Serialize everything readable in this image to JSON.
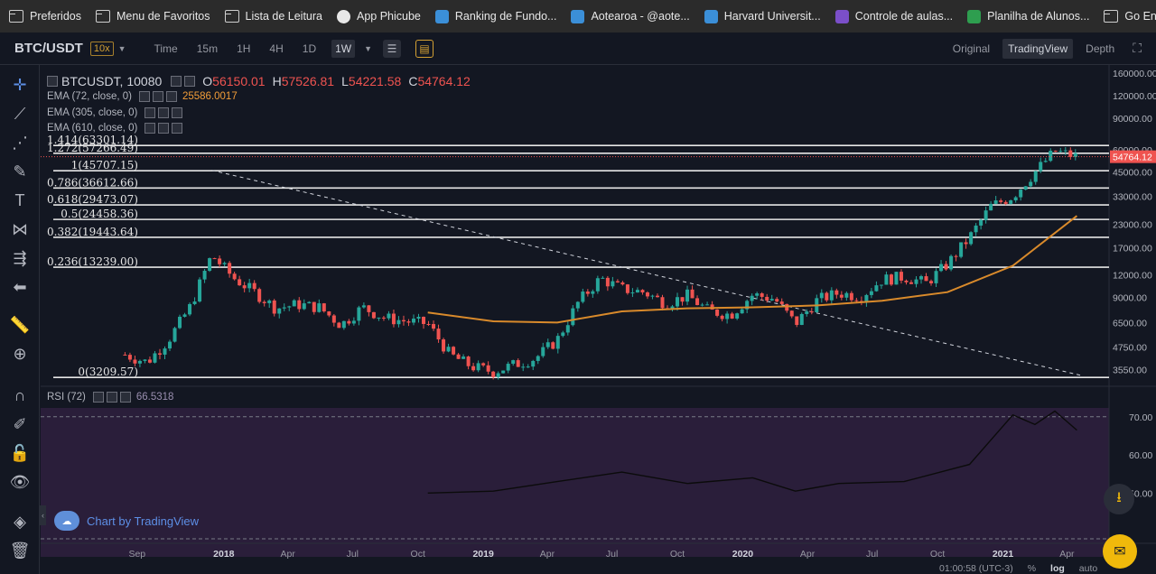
{
  "bookmarks": [
    {
      "label": "Preferidos",
      "icon": "folder-icon"
    },
    {
      "label": "Menu de Favoritos",
      "icon": "folder-icon"
    },
    {
      "label": "Lista de Leitura",
      "icon": "folder-icon"
    },
    {
      "label": "App Phicube",
      "icon": "globe-icon"
    },
    {
      "label": "Ranking de Fundo...",
      "icon": "site-icon"
    },
    {
      "label": "Aotearoa - @aote...",
      "icon": "site-icon"
    },
    {
      "label": "Harvard Universit...",
      "icon": "site-icon"
    },
    {
      "label": "Controle de aulas...",
      "icon": "form-icon"
    },
    {
      "label": "Planilha de Alunos...",
      "icon": "sheet-icon"
    },
    {
      "label": "Go English",
      "icon": "folder-icon"
    }
  ],
  "toolbar": {
    "pair": "BTC/USDT",
    "leverage": "10x",
    "timeframes": [
      "Time",
      "15m",
      "1H",
      "4H",
      "1D",
      "1W"
    ],
    "active_timeframe": "1W",
    "views": [
      "Original",
      "TradingView",
      "Depth"
    ],
    "active_view": "TradingView"
  },
  "legend": {
    "symbol": "BTCUSDT, 10080",
    "o_label": "O",
    "o": "56150.01",
    "h_label": "H",
    "h": "57526.81",
    "l_label": "L",
    "l": "54221.58",
    "c_label": "C",
    "c": "54764.12",
    "ema72": "EMA (72, close, 0)",
    "ema72_value": "25586.0017",
    "ema305": "EMA (305, close, 0)",
    "ema610": "EMA (610, close, 0)",
    "rsi": "RSI (72)",
    "rsi_value": "66.5318"
  },
  "price_axis": [
    "160000.00",
    "120000.00",
    "90000.00",
    "60000.00",
    "45000.00",
    "33000.00",
    "23000.00",
    "17000.00",
    "12000.00",
    "9000.00",
    "6500.00",
    "4750.00",
    "3550.00"
  ],
  "current_price": "54764.12",
  "rsi_axis": [
    "70.00",
    "60.00",
    "50.00"
  ],
  "time_axis": [
    "Sep",
    "2018",
    "Apr",
    "Jul",
    "Oct",
    "2019",
    "Apr",
    "Jul",
    "Oct",
    "2020",
    "Apr",
    "Jul",
    "Oct",
    "2021",
    "Apr"
  ],
  "fib_levels": [
    {
      "label": "1.414(63301.14)",
      "price": 63301.14
    },
    {
      "label": "1.272(57266.49)",
      "price": 57266.49
    },
    {
      "label": "1(45707.15)",
      "price": 45707.15
    },
    {
      "label": "0.786(36612.66)",
      "price": 36612.66
    },
    {
      "label": "0.618(29473.07)",
      "price": 29473.07
    },
    {
      "label": "0.5(24458.36)",
      "price": 24458.36
    },
    {
      "label": "0.382(19443.64)",
      "price": 19443.64
    },
    {
      "label": "0.236(13239.00)",
      "price": 13239.0
    },
    {
      "label": "0(3209.57)",
      "price": 3209.57
    }
  ],
  "colors": {
    "up": "#26a69a",
    "down": "#ef5350",
    "ema": "#d98a2b",
    "rsi_band": "#2a1e3a",
    "background": "#131722",
    "accent": "#f0b90b"
  },
  "watermark": "Chart by TradingView",
  "status": {
    "time": "01:00:58 (UTC-3)",
    "percent": "%",
    "log": "log",
    "auto": "auto"
  },
  "chart_data": {
    "type": "candlestick",
    "scale": "log",
    "ylim": [
      3000,
      170000
    ],
    "x_ticks": [
      "Sep",
      "2018",
      "Apr",
      "Jul",
      "Oct",
      "2019",
      "Apr",
      "Jul",
      "Oct",
      "2020",
      "Apr",
      "Jul",
      "Oct",
      "2021",
      "Apr"
    ],
    "close_path": [
      [
        "2017-08",
        4300
      ],
      [
        "2017-09",
        3900
      ],
      [
        "2017-10",
        5200
      ],
      [
        "2017-11",
        8000
      ],
      [
        "2017-12",
        15500
      ],
      [
        "2018-01",
        11500
      ],
      [
        "2018-02",
        9500
      ],
      [
        "2018-03",
        7800
      ],
      [
        "2018-04",
        8200
      ],
      [
        "2018-05",
        7900
      ],
      [
        "2018-06",
        6300
      ],
      [
        "2018-07",
        7900
      ],
      [
        "2018-08",
        6900
      ],
      [
        "2018-09",
        6600
      ],
      [
        "2018-10",
        6400
      ],
      [
        "2018-11",
        4300
      ],
      [
        "2018-12",
        3700
      ],
      [
        "2019-01",
        3450
      ],
      [
        "2019-02",
        3800
      ],
      [
        "2019-03",
        4100
      ],
      [
        "2019-04",
        5200
      ],
      [
        "2019-05",
        8500
      ],
      [
        "2019-06",
        11500
      ],
      [
        "2019-07",
        10000
      ],
      [
        "2019-08",
        9600
      ],
      [
        "2019-09",
        8300
      ],
      [
        "2019-10",
        9200
      ],
      [
        "2019-11",
        7500
      ],
      [
        "2019-12",
        7200
      ],
      [
        "2020-01",
        9300
      ],
      [
        "2020-02",
        8800
      ],
      [
        "2020-03",
        6400
      ],
      [
        "2020-04",
        8700
      ],
      [
        "2020-05",
        9500
      ],
      [
        "2020-06",
        9100
      ],
      [
        "2020-07",
        11300
      ],
      [
        "2020-08",
        11700
      ],
      [
        "2020-09",
        10800
      ],
      [
        "2020-10",
        13800
      ],
      [
        "2020-11",
        19400
      ],
      [
        "2020-12",
        29000
      ],
      [
        "2021-01",
        33000
      ],
      [
        "2021-02",
        45000
      ],
      [
        "2021-03",
        58800
      ],
      [
        "2021-04",
        54764
      ]
    ],
    "ema72_path": [
      [
        "2018-10",
        7400
      ],
      [
        "2019-01",
        6600
      ],
      [
        "2019-04",
        6500
      ],
      [
        "2019-07",
        7500
      ],
      [
        "2019-10",
        7800
      ],
      [
        "2020-01",
        7900
      ],
      [
        "2020-04",
        8100
      ],
      [
        "2020-07",
        8600
      ],
      [
        "2020-10",
        9600
      ],
      [
        "2021-01",
        13500
      ],
      [
        "2021-04",
        25586
      ]
    ],
    "rsi_path": [
      [
        "2018-10",
        50.0
      ],
      [
        "2019-01",
        50.5
      ],
      [
        "2019-04",
        53.0
      ],
      [
        "2019-07",
        55.5
      ],
      [
        "2019-10",
        52.5
      ],
      [
        "2020-01",
        54.0
      ],
      [
        "2020-03",
        50.5
      ],
      [
        "2020-05",
        52.5
      ],
      [
        "2020-08",
        53.0
      ],
      [
        "2020-11",
        57.5
      ],
      [
        "2021-01",
        70.5
      ],
      [
        "2021-02",
        68.0
      ],
      [
        "2021-03",
        71.5
      ],
      [
        "2021-04",
        66.5
      ]
    ],
    "rsi_band": [
      30,
      70
    ]
  }
}
